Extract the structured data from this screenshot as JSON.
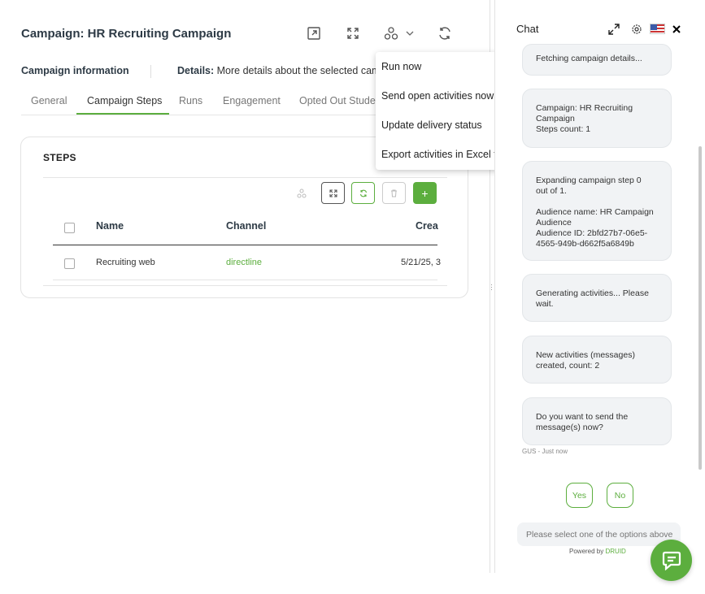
{
  "header": {
    "title": "Campaign: HR Recruiting Campaign",
    "icons": [
      "open-external-icon",
      "expand-icon",
      "workflow-icon",
      "chevron-down-icon",
      "refresh-icon"
    ]
  },
  "info": {
    "campaign_info": "Campaign information",
    "details_label": "Details:",
    "details_text": "More details about the selected camp"
  },
  "tabs": [
    {
      "label": "General"
    },
    {
      "label": "Campaign Steps"
    },
    {
      "label": "Runs"
    },
    {
      "label": "Engagement"
    },
    {
      "label": "Opted Out Studer"
    }
  ],
  "active_tab": "Campaign Steps",
  "steps": {
    "title": "STEPS",
    "toolbar": {
      "add_label": "+"
    },
    "columns": [
      "Name",
      "Channel",
      "Crea"
    ],
    "rows": [
      {
        "name": "Recruiting web",
        "channel": "directline",
        "created": "5/21/25, 3"
      }
    ]
  },
  "menu": {
    "items": [
      "Run now",
      "Send open activities now",
      "Update delivery status",
      "Export activities in Excel file"
    ]
  },
  "chat": {
    "title": "Chat",
    "messages": [
      "Fetching campaign details...",
      "Campaign: HR Recruiting\nCampaign\nSteps count: 1",
      "Expanding campaign step 0\nout of 1.\n\nAudience name: HR Campaign\nAudience\nAudience ID: 2bfd27b7-06e5-\n4565-949b-d662f5a6849b",
      "Generating activities... Please\nwait.",
      "New activities (messages)\ncreated, count: 2",
      "Do you want to send the\nmessage(s) now?"
    ],
    "stamp": "GUS - Just now",
    "quick_replies": [
      "Yes",
      "No"
    ],
    "input_placeholder": "Please select one of the options above",
    "powered_by": "Powered by",
    "brand": "DRUID"
  },
  "colors": {
    "accent": "#5cae3e",
    "title": "#2d3a45"
  }
}
